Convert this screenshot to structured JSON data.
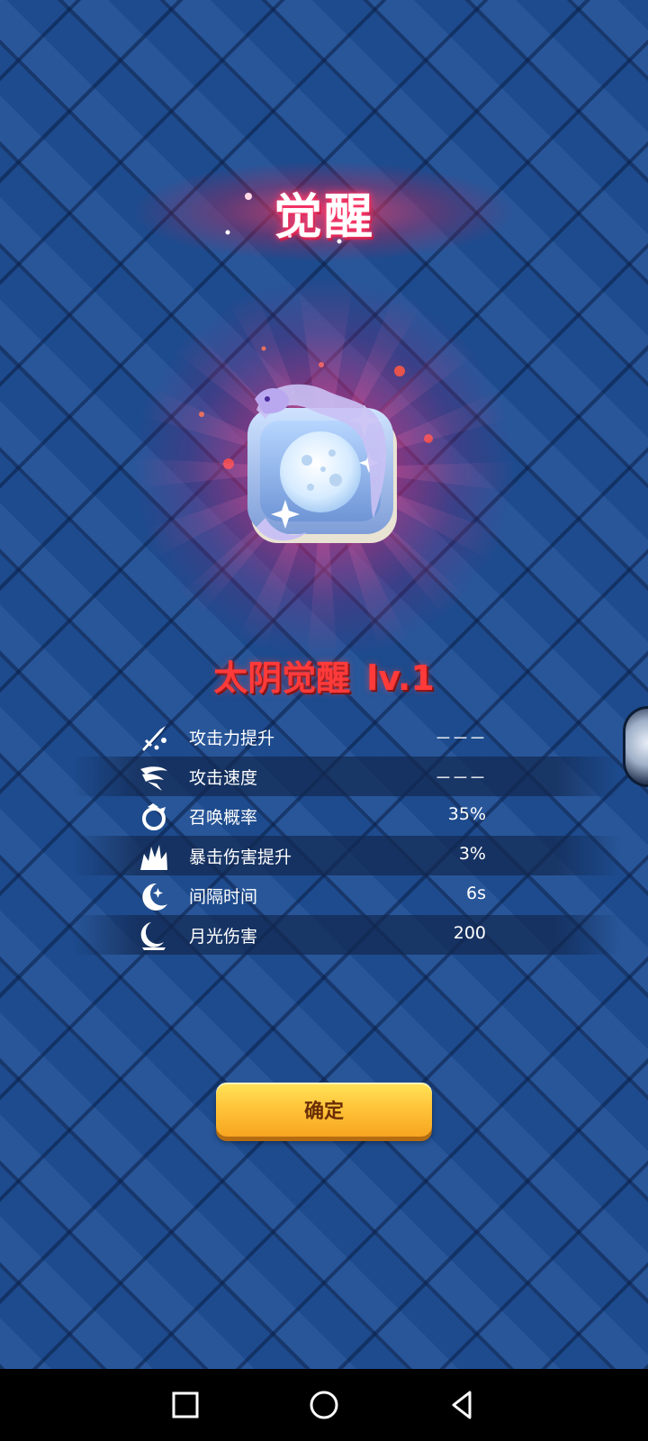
{
  "title": "觉醒",
  "skill": {
    "name": "太阴觉醒",
    "level": "lv.1",
    "icon": "moon-dragon-icon"
  },
  "stats": [
    {
      "icon": "sword-attack-icon",
      "label": "攻击力提升",
      "value": "－－－"
    },
    {
      "icon": "wing-speed-icon",
      "label": "攻击速度",
      "value": "－－－"
    },
    {
      "icon": "dragon-ring-icon",
      "label": "召唤概率",
      "value": "35%"
    },
    {
      "icon": "burst-icon",
      "label": "暴击伤害提升",
      "value": "3%"
    },
    {
      "icon": "crescent-moon-icon",
      "label": "间隔时间",
      "value": "6s"
    },
    {
      "icon": "moonlight-icon",
      "label": "月光伤害",
      "value": "200"
    }
  ],
  "confirm_button": {
    "label": "确定"
  },
  "side_avatar": {
    "icon": "character-avatar-icon"
  },
  "nav": {
    "recent": "square-icon",
    "home": "circle-icon",
    "back": "triangle-back-icon"
  },
  "colors": {
    "background": "#1f4f95",
    "title_glow": "#ff3a6c",
    "skill_name": "#ff3a3a",
    "button": "#ffc53a"
  }
}
